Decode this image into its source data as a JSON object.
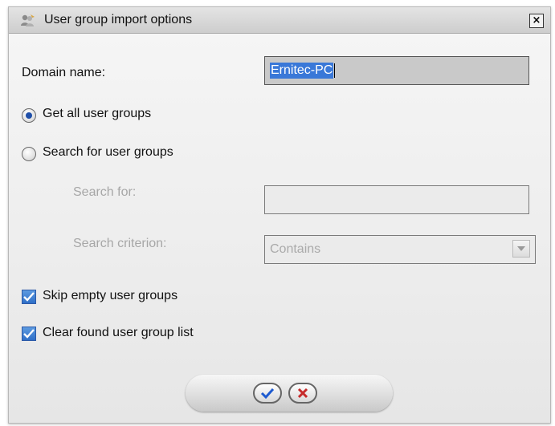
{
  "window": {
    "title": "User group import options",
    "close_glyph": "×"
  },
  "form": {
    "domain_label": "Domain name:",
    "domain_value": "Ernitec-PC",
    "radio_all_label": "Get all user groups",
    "radio_all_selected": true,
    "radio_search_label": "Search for user groups",
    "radio_search_selected": false,
    "search_for_label": "Search for:",
    "search_for_value": "",
    "criterion_label": "Search criterion:",
    "criterion_value": "Contains",
    "skip_empty_label": "Skip empty user groups",
    "skip_empty_checked": true,
    "clear_found_label": "Clear found user group list",
    "clear_found_checked": true
  },
  "buttons": {
    "ok_icon": "checkmark-icon",
    "cancel_icon": "x-icon"
  },
  "colors": {
    "selection": "#3a78d8",
    "checkbox": "#2f6fc8",
    "ok_check": "#1e5bd0",
    "cancel_x": "#c62b2b"
  }
}
